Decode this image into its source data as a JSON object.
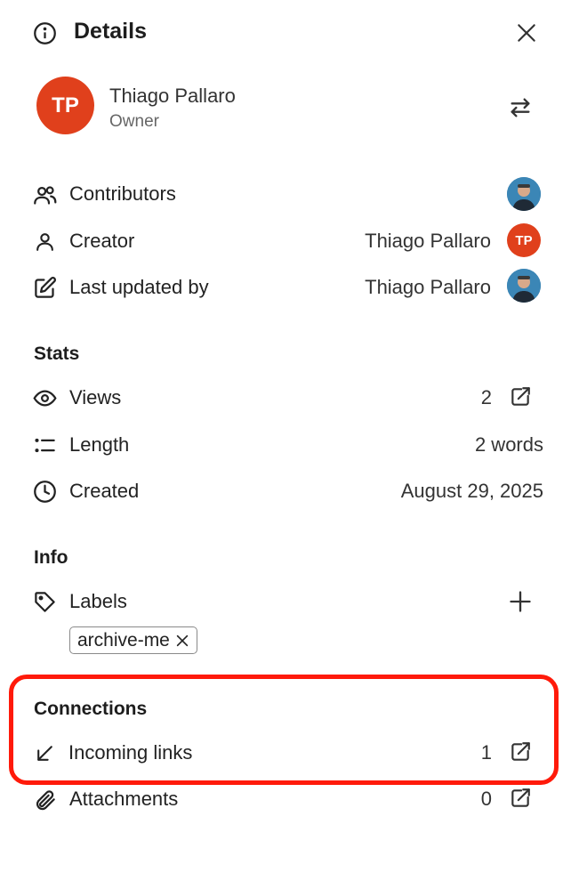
{
  "header": {
    "title": "Details"
  },
  "owner": {
    "initials": "TP",
    "name": "Thiago Pallaro",
    "role": "Owner",
    "avatar_color": "#e0401c"
  },
  "people": {
    "contributors_label": "Contributors",
    "creator_label": "Creator",
    "creator_name": "Thiago Pallaro",
    "creator_initials": "TP",
    "updated_label": "Last updated by",
    "updated_name": "Thiago Pallaro"
  },
  "stats": {
    "heading": "Stats",
    "views_label": "Views",
    "views_value": "2",
    "length_label": "Length",
    "length_value": "2 words",
    "created_label": "Created",
    "created_value": "August 29, 2025"
  },
  "info": {
    "heading": "Info",
    "labels_label": "Labels",
    "labels": [
      "archive-me"
    ]
  },
  "connections": {
    "heading": "Connections",
    "incoming_label": "Incoming links",
    "incoming_value": "1",
    "attachments_label": "Attachments",
    "attachments_value": "0",
    "highlight_color": "#ff1a0a"
  },
  "icons": [
    "info-icon",
    "close-icon",
    "swap-icon",
    "users-icon",
    "user-icon",
    "edit-icon",
    "eye-icon",
    "list-icon",
    "clock-icon",
    "tag-icon",
    "plus-icon",
    "arrow-down-left-icon",
    "paperclip-icon",
    "external-link-icon"
  ]
}
